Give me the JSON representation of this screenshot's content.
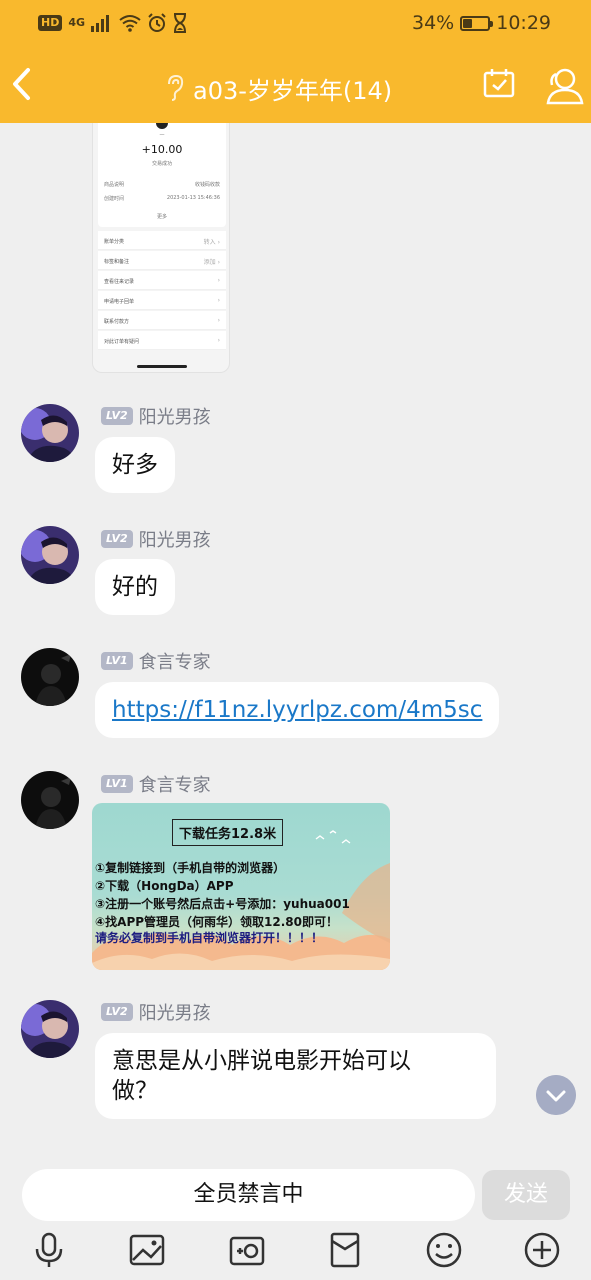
{
  "status_bar": {
    "hd": "HD",
    "network": "4G",
    "battery_text": "34%",
    "battery_level": 0.34,
    "time": "10:29"
  },
  "header": {
    "title": "a03-岁岁年年(14)"
  },
  "shared_screenshot": {
    "amount": "+10.00",
    "status": "交易成功",
    "rows": [
      {
        "label": "商品说明",
        "value": "收钱码收款"
      },
      {
        "label": "创建时间",
        "value": "2023-01-13 15:46:36"
      }
    ],
    "more": "更多",
    "menu": [
      "账单分类",
      "标签和备注",
      "查看往来记录",
      "申请电子回单",
      "联系付款方",
      "对此订单有疑问"
    ],
    "menu_values": [
      "转入",
      "添加",
      "",
      "",
      "",
      ""
    ]
  },
  "messages": [
    {
      "level": "LV2",
      "name": "阳光男孩",
      "text": "好多"
    },
    {
      "level": "LV2",
      "name": "阳光男孩",
      "text": "好的"
    },
    {
      "level": "LV1",
      "name": "食言专家",
      "text": "https://f11nz.lyyrlpz.com/4m5sc"
    },
    {
      "level": "LV1",
      "name": "食言专家"
    },
    {
      "level": "LV2",
      "name": "阳光男孩",
      "text_line1": "意思是从小胖说电影开始可以",
      "text_line2": "做？"
    }
  ],
  "poster": {
    "title": "下载任务12.8米",
    "lines": [
      "①复制链接到（手机自带的浏览器）",
      "②下载（HongDa）APP",
      "③注册一个账号然后点击+号添加：yuhua001",
      "④找APP管理员（何雨华）领取12.80即可！",
      "请务必复制到手机自带浏览器打开！！！！"
    ]
  },
  "input": {
    "muted_text": "全员禁言中",
    "send_label": "发送"
  },
  "colors": {
    "header_bg": "#f9b92d",
    "link": "#1a78c8",
    "level_badge": "#b3b7c7"
  },
  "icons": [
    "back-arrow-icon",
    "ear-icon",
    "calendar-check-icon",
    "group-members-icon",
    "chevron-down-icon",
    "microphone-icon",
    "image-icon",
    "camera-icon",
    "red-packet-icon",
    "emoji-icon",
    "plus-icon"
  ]
}
